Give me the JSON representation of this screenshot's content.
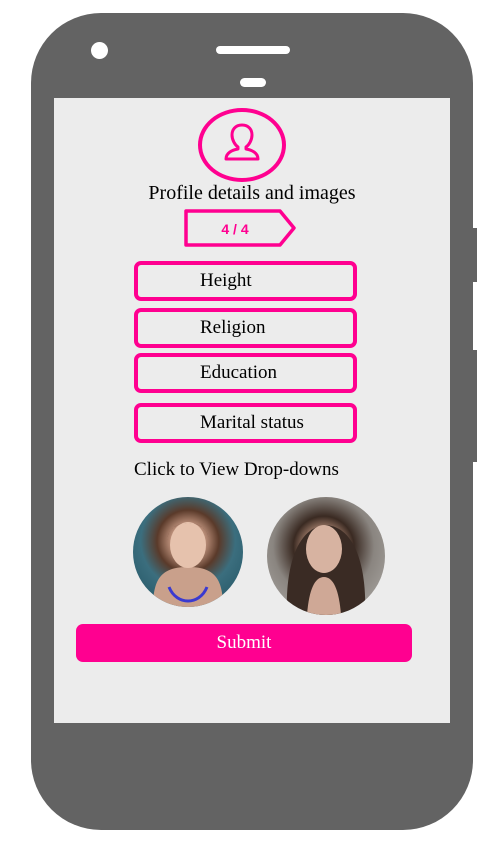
{
  "header": {
    "title": "Profile details and images",
    "step": "4 / 4"
  },
  "fields": [
    {
      "label": "Height"
    },
    {
      "label": "Religion"
    },
    {
      "label": "Education"
    },
    {
      "label": "Marital status"
    }
  ],
  "hint": "Click to View Drop-downs",
  "submit_label": "Submit",
  "colors": {
    "accent": "#ff0090",
    "screen": "#ececec",
    "device": "#636363"
  },
  "icons": [
    "user-profile-icon"
  ]
}
